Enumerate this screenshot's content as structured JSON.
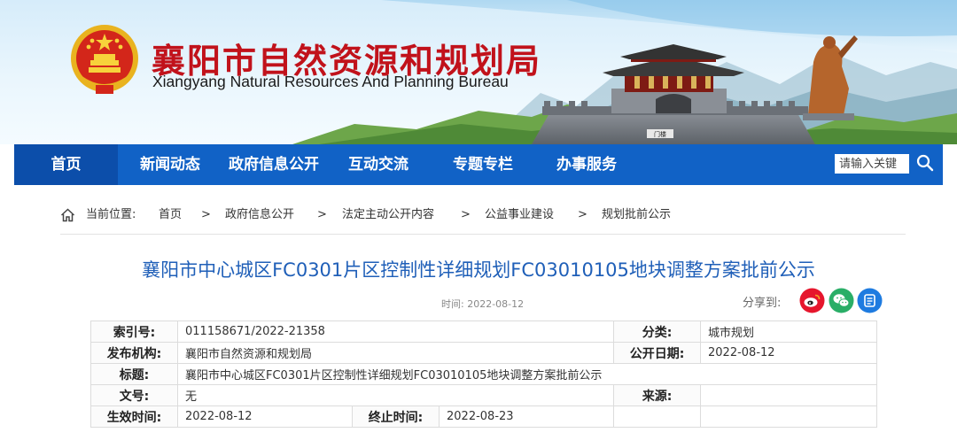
{
  "header": {
    "title": "襄阳市自然资源和规划局",
    "subtitle": "Xiangyang Natural Resources And Planning Bureau",
    "sign_text": "门楼"
  },
  "nav": {
    "items": [
      "首页",
      "新闻动态",
      "政府信息公开",
      "互动交流",
      "专题专栏",
      "办事服务"
    ],
    "active_index": 0,
    "search_placeholder": "请输入关键",
    "color": "#1162c6",
    "active_color": "#0c4eaa"
  },
  "breadcrumb": {
    "label": "当前位置:",
    "items": [
      "首页",
      "政府信息公开",
      "法定主动公开内容",
      "公益事业建设",
      "规划批前公示"
    ],
    "separator": ">"
  },
  "article": {
    "title": "襄阳市中心城区FC0301片区控制性详细规划FC03010105地块调整方案批前公示",
    "time": "时间: 2022-08-12",
    "share_label": "分享到:",
    "share_icons": [
      "weibo-icon",
      "wechat-icon",
      "qzone-icon"
    ],
    "title_color": "#1f5fb8"
  },
  "meta": {
    "index_no_label": "索引号:",
    "index_no": "011158671/2022-21358",
    "category_label": "分类:",
    "category": "城市规划",
    "publisher_label": "发布机构:",
    "publisher": "襄阳市自然资源和规划局",
    "publish_date_label": "公开日期:",
    "publish_date": "2022-08-12",
    "title_label": "标题:",
    "title": "襄阳市中心城区FC0301片区控制性详细规划FC03010105地块调整方案批前公示",
    "doc_no_label": "文号:",
    "doc_no": "无",
    "source_label": "来源:",
    "source": "",
    "effective_label": "生效时间:",
    "effective": "2022-08-12",
    "end_label": "终止时间:",
    "end": "2022-08-23"
  }
}
